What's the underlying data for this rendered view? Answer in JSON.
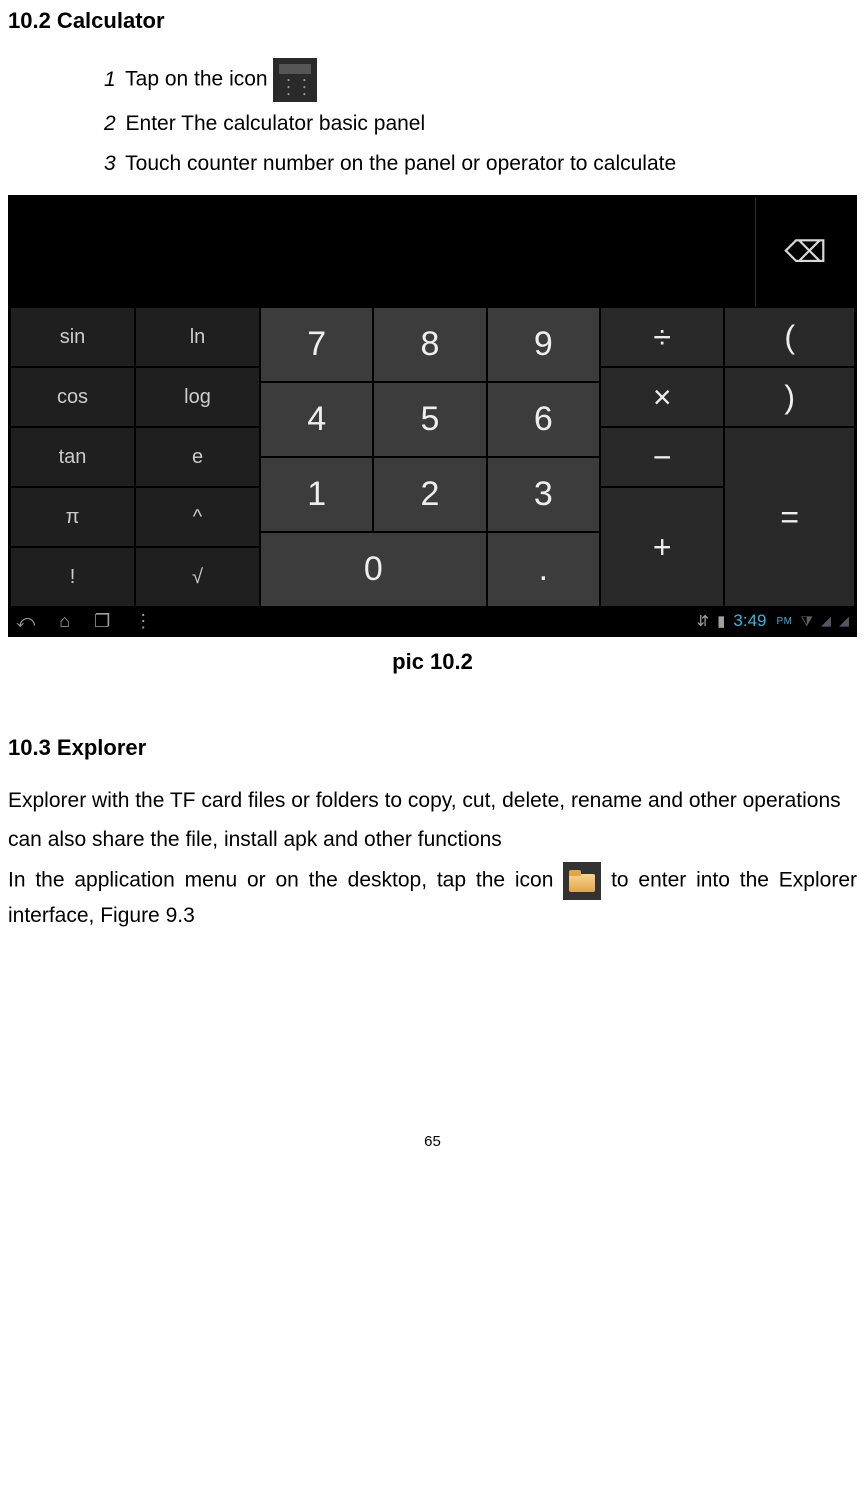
{
  "section_calc": {
    "heading": "10.2 Calculator",
    "steps": [
      {
        "num": "1",
        "text": "Tap on the icon"
      },
      {
        "num": "2",
        "text": "Enter The calculator basic panel"
      },
      {
        "num": "3",
        "text": "Touch counter number on the panel or operator to calculate"
      }
    ],
    "caption": "pic 10.2"
  },
  "calculator": {
    "backspace": "⌫",
    "sci": [
      "sin",
      "ln",
      "cos",
      "log",
      "tan",
      "e",
      "π",
      "^",
      "!",
      "√"
    ],
    "num": [
      "7",
      "8",
      "9",
      "4",
      "5",
      "6",
      "1",
      "2",
      "3",
      "0",
      "."
    ],
    "ops": {
      "div": "÷",
      "lpar": "(",
      "mul": "×",
      "rpar": ")",
      "sub": "−",
      "eq": "=",
      "add": "+"
    }
  },
  "statusbar": {
    "time": "3:49",
    "ampm": "PM"
  },
  "section_explorer": {
    "heading": "10.3 Explorer",
    "p1": "Explorer with the TF card files or folders to copy, cut, delete, rename and other operations",
    "p2": "can also share the file, install apk and other functions",
    "p3a": "In the application menu or on the desktop, tap the icon ",
    "p3b": " to enter into the Explorer interface, Figure 9.3"
  },
  "page_number": "65"
}
